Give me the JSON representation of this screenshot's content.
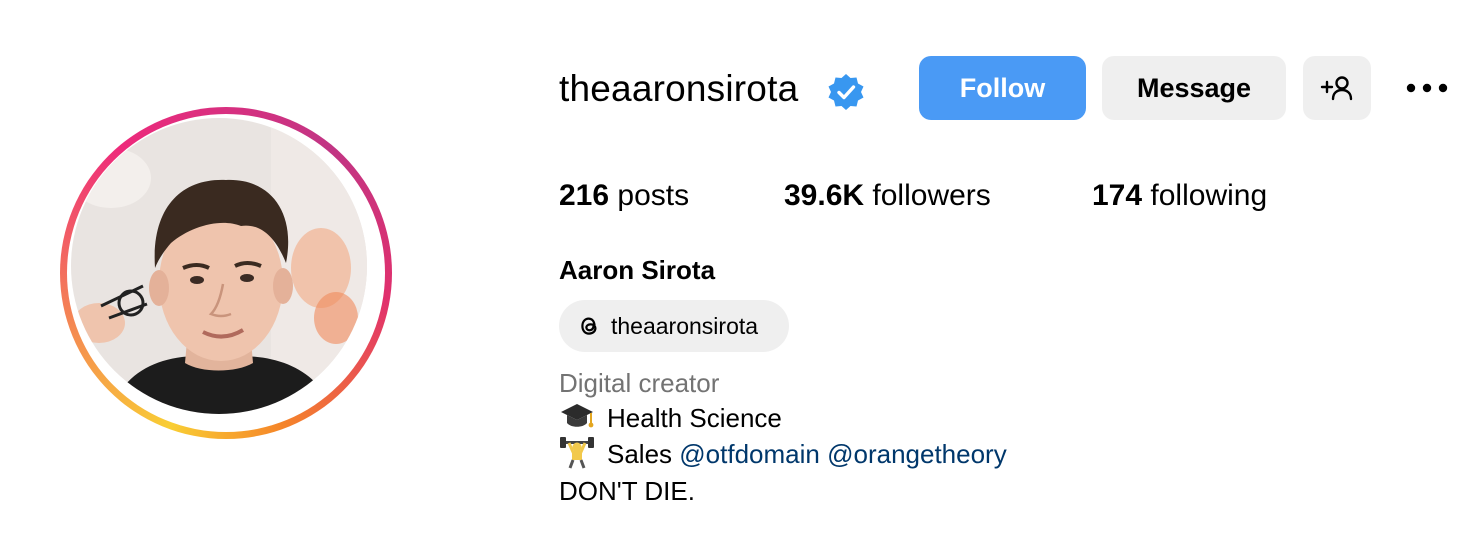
{
  "profile": {
    "username": "theaaronsirota",
    "full_name": "Aaron Sirota",
    "category": "Digital creator",
    "verified": true
  },
  "actions": {
    "follow_label": "Follow",
    "message_label": "Message",
    "add_user_icon": "person-add-icon",
    "more_icon": "more-horizontal-icon"
  },
  "stats": {
    "posts_count": "216",
    "posts_label": "posts",
    "followers_count": "39.6K",
    "followers_label": "followers",
    "following_count": "174",
    "following_label": "following"
  },
  "threads": {
    "handle": "theaaronsirota",
    "icon": "threads-icon"
  },
  "bio": {
    "line1_emoji": "graduation-cap-icon",
    "line1_text": "Health Science",
    "line2_emoji": "weight-lifter-icon",
    "line2_text": "Sales",
    "line2_mention1": "@otfdomain",
    "line2_mention2": "@orangetheory",
    "line3_text": "DON'T DIE."
  },
  "colors": {
    "accent_blue": "#4a9af5",
    "verified_blue": "#3897f0",
    "mention_blue": "#00376b",
    "secondary_text": "#737373",
    "button_gray": "#efefef"
  }
}
